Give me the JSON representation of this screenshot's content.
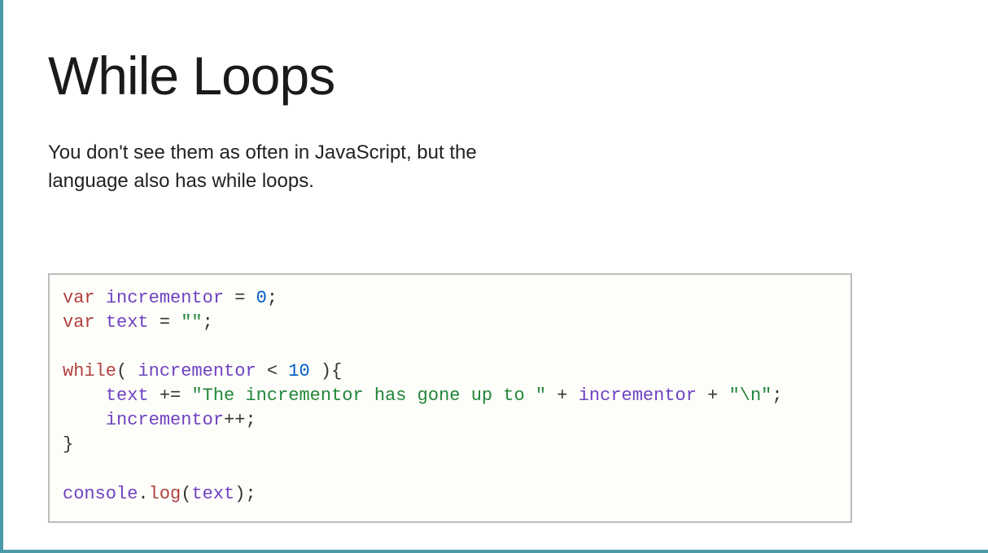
{
  "heading": "While Loops",
  "subtitle": "You don't see them as often in JavaScript, but the language also has while loops.",
  "code": {
    "l1_kw": "var",
    "l1_id": "incrementor",
    "l1_eq": " = ",
    "l1_num": "0",
    "l1_semi": ";",
    "l2_kw": "var",
    "l2_id": "text",
    "l2_eq": " = ",
    "l2_str": "\"\"",
    "l2_semi": ";",
    "l3_blank": "",
    "l4_kw": "while",
    "l4_open": "( ",
    "l4_id": "incrementor",
    "l4_op": " < ",
    "l4_num": "10",
    "l4_close": " ){",
    "l5_indent": "    ",
    "l5_id": "text",
    "l5_op": " += ",
    "l5_str": "\"The incrementor has gone up to \"",
    "l5_plus1": " + ",
    "l5_id2": "incrementor",
    "l5_plus2": " + ",
    "l5_str2": "\"\\n\"",
    "l5_semi": ";",
    "l6_indent": "    ",
    "l6_id": "incrementor",
    "l6_op": "++;",
    "l7_close": "}",
    "l8_blank": "",
    "l9_obj": "console",
    "l9_dot": ".",
    "l9_fn": "log",
    "l9_open": "(",
    "l9_arg": "text",
    "l9_close": ");"
  }
}
